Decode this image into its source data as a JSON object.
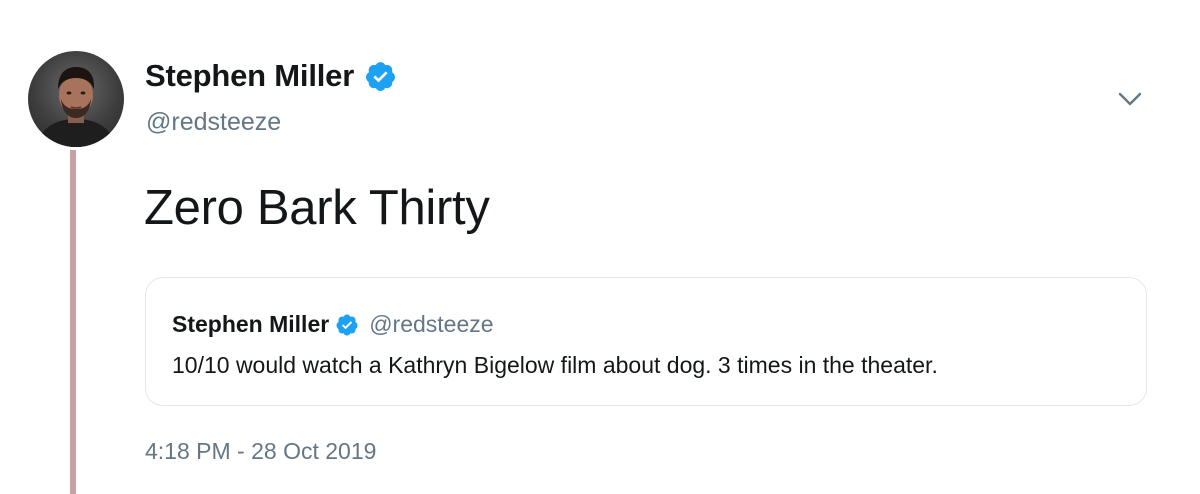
{
  "author": {
    "display_name": "Stephen Miller",
    "handle": "@redsteeze",
    "verified": true,
    "avatar_icon": "user-photo-avatar"
  },
  "tweet": {
    "text": "Zero Bark Thirty",
    "timestamp": "4:18 PM - 28 Oct 2019"
  },
  "quoted_tweet": {
    "display_name": "Stephen Miller",
    "handle": "@redsteeze",
    "verified": true,
    "text": "10/10 would watch a Kathryn Bigelow film about dog. 3 times in the theater."
  },
  "icons": {
    "verified": "verified-badge-icon",
    "menu": "chevron-down-icon"
  },
  "colors": {
    "verified_blue": "#1da1f2",
    "secondary_text": "#657786",
    "primary_text": "#14171a",
    "thread_line": "#c9a0a3",
    "border": "#e1e8ed"
  }
}
